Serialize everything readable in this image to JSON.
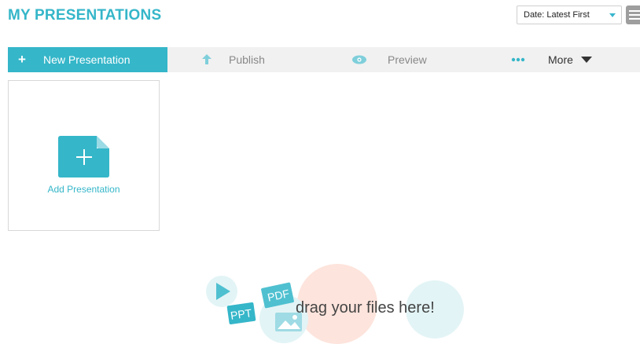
{
  "header": {
    "title": "MY PRESENTATIONS",
    "sort_select": "Date: Latest First"
  },
  "toolbar": {
    "new_presentation": "New Presentation",
    "publish": "Publish",
    "preview": "Preview",
    "more": "More"
  },
  "card": {
    "label": "Add Presentation"
  },
  "dropzone": {
    "text": "drag your files here!",
    "ppt_badge": "PPT",
    "pdf_badge": "PDF"
  },
  "colors": {
    "accent": "#35b6c9",
    "toolbar_bg": "#f1f1f1",
    "peach": "#fde4dc",
    "light_teal": "#e3f4f6"
  },
  "icons": {
    "new": "plus-icon",
    "publish": "upload-arrow-icon",
    "preview": "eye-icon",
    "more": "dots-icon",
    "more_caret": "caret-down-icon",
    "view": "list-view-icon",
    "add": "add-file-icon"
  }
}
